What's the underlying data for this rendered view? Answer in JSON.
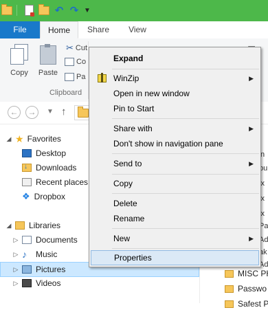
{
  "ribbon": {
    "tabs": [
      "File",
      "Home",
      "Share",
      "View"
    ],
    "copy_label": "Copy",
    "paste_label": "Paste",
    "cut_label": "Cut",
    "copy_path_partial": "Co",
    "paste_shortcut_partial": "Pa",
    "group_clipboard": "Clipboard"
  },
  "nav_pane": {
    "favorites": "Favorites",
    "desktop": "Desktop",
    "downloads": "Downloads",
    "recent_places": "Recent places",
    "dropbox": "Dropbox",
    "libraries": "Libraries",
    "documents": "Documents",
    "music": "Music",
    "pictures": "Pictures",
    "videos": "Videos"
  },
  "file_list": {
    "clipped_right": [
      "n",
      "bu",
      "ix",
      "ix",
      "ix",
      "Pa",
      "Ad",
      "ak",
      "Ad"
    ],
    "folders": [
      "MISC PH",
      "Passwo",
      "Safest P"
    ]
  },
  "context_menu": {
    "expand": "Expand",
    "winzip": "WinZip",
    "open_new_window": "Open in new window",
    "pin_to_start": "Pin to Start",
    "share_with": "Share with",
    "dont_show_nav": "Don't show in navigation pane",
    "send_to": "Send to",
    "copy": "Copy",
    "delete": "Delete",
    "rename": "Rename",
    "new": "New",
    "properties": "Properties"
  },
  "colors": {
    "titlebar": "#4db84a",
    "file_tab": "#1979ca",
    "selection": "#cce8ff",
    "menu_highlight": "#dbe9f6"
  }
}
